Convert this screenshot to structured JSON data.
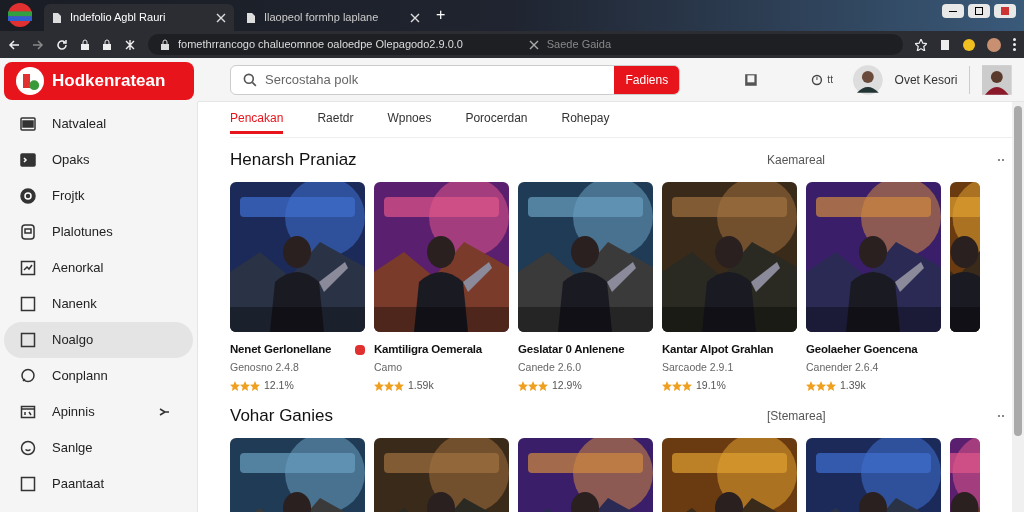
{
  "browser": {
    "tabs": [
      {
        "title": "Indefolio Agbl Rauri",
        "selected": true
      },
      {
        "title": "Ilaopeol formhp laplane",
        "selected": false
      }
    ],
    "new_tab": "+",
    "address": "fomethrrancogo chalueomnoe oaloedpe Olepagodo2.9.0.0",
    "address_search": "Saede Gaida"
  },
  "header": {
    "logo": "Hodkenratean",
    "search": {
      "placeholder": "Sercostaha polk"
    },
    "search_button": "Fadiens",
    "clock_label": "tt",
    "user_name": "Ovet Kesori"
  },
  "sidebar": {
    "items": [
      {
        "label": "Natvaleal",
        "selected": false
      },
      {
        "label": "Opaks",
        "selected": false
      },
      {
        "label": "Frojtk",
        "selected": false
      },
      {
        "label": "Plalotunes",
        "selected": false
      },
      {
        "label": "Aenorkal",
        "selected": false
      },
      {
        "label": "Nanenk",
        "selected": false
      },
      {
        "label": "Noalgo",
        "selected": true
      },
      {
        "label": "Conplann",
        "selected": false
      },
      {
        "label": "Apinnis",
        "selected": false,
        "pinned": true
      },
      {
        "label": "Sanlge",
        "selected": false
      },
      {
        "label": "Paantaat",
        "selected": false
      }
    ]
  },
  "tabs": [
    {
      "label": "Pencakan",
      "selected": true
    },
    {
      "label": "Raetdr",
      "selected": false
    },
    {
      "label": "Wpnoes",
      "selected": false
    },
    {
      "label": "Porocerdan",
      "selected": false
    },
    {
      "label": "Rohepay",
      "selected": false
    }
  ],
  "sections": [
    {
      "title": "Henarsh Praniaz",
      "link": "Kaemareal",
      "cards": [
        {
          "title": "Nenet Gerlonellane",
          "subtitle": "Genosno 2.4.8",
          "stars": 3,
          "rating": "12.1%",
          "badge": true
        },
        {
          "title": "Kamtiligra Oemerala",
          "subtitle": "Camo",
          "stars": 3,
          "rating": "1.59k",
          "badge": false
        },
        {
          "title": "Geslatar 0 Anlenene",
          "subtitle": "Canede 2.6.0",
          "stars": 3,
          "rating": "12.9%",
          "badge": false
        },
        {
          "title": "Kantar Alpot Grahlan",
          "subtitle": "Sarcaode 2.9.1",
          "stars": 3,
          "rating": "19.1%",
          "badge": false
        },
        {
          "title": "Geolaeher Goencena",
          "subtitle": "Canender 2.6.4",
          "stars": 3,
          "rating": "1.39k",
          "badge": false
        }
      ]
    },
    {
      "title": "Vohar Ganies",
      "link": "[Stemarea]"
    }
  ]
}
